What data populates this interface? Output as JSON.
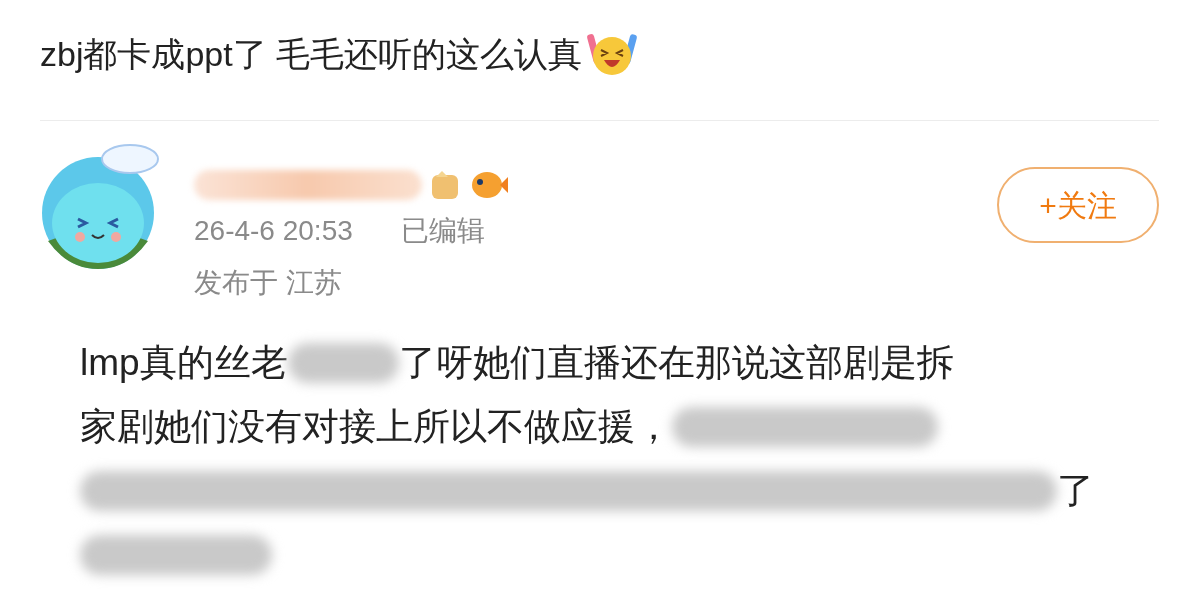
{
  "caption": "zbj都卡成ppt了 毛毛还听的这么认真",
  "post": {
    "time": "26-4-6 20:53",
    "edited": "已编辑",
    "location": "发布于 江苏",
    "follow_button": "+关注",
    "body_lines": [
      [
        {
          "kind": "text",
          "text": "lmp真的丝老"
        },
        {
          "kind": "blur"
        },
        {
          "kind": "text",
          "text": "了呀她们直播还在那说这部剧是拆"
        }
      ],
      [
        {
          "kind": "text",
          "text": "家剧她们没有对接上所以不做应援，"
        },
        {
          "kind": "blur"
        }
      ],
      [
        {
          "kind": "blur"
        },
        {
          "kind": "text",
          "text": "了"
        }
      ],
      [
        {
          "kind": "blur"
        }
      ]
    ]
  }
}
